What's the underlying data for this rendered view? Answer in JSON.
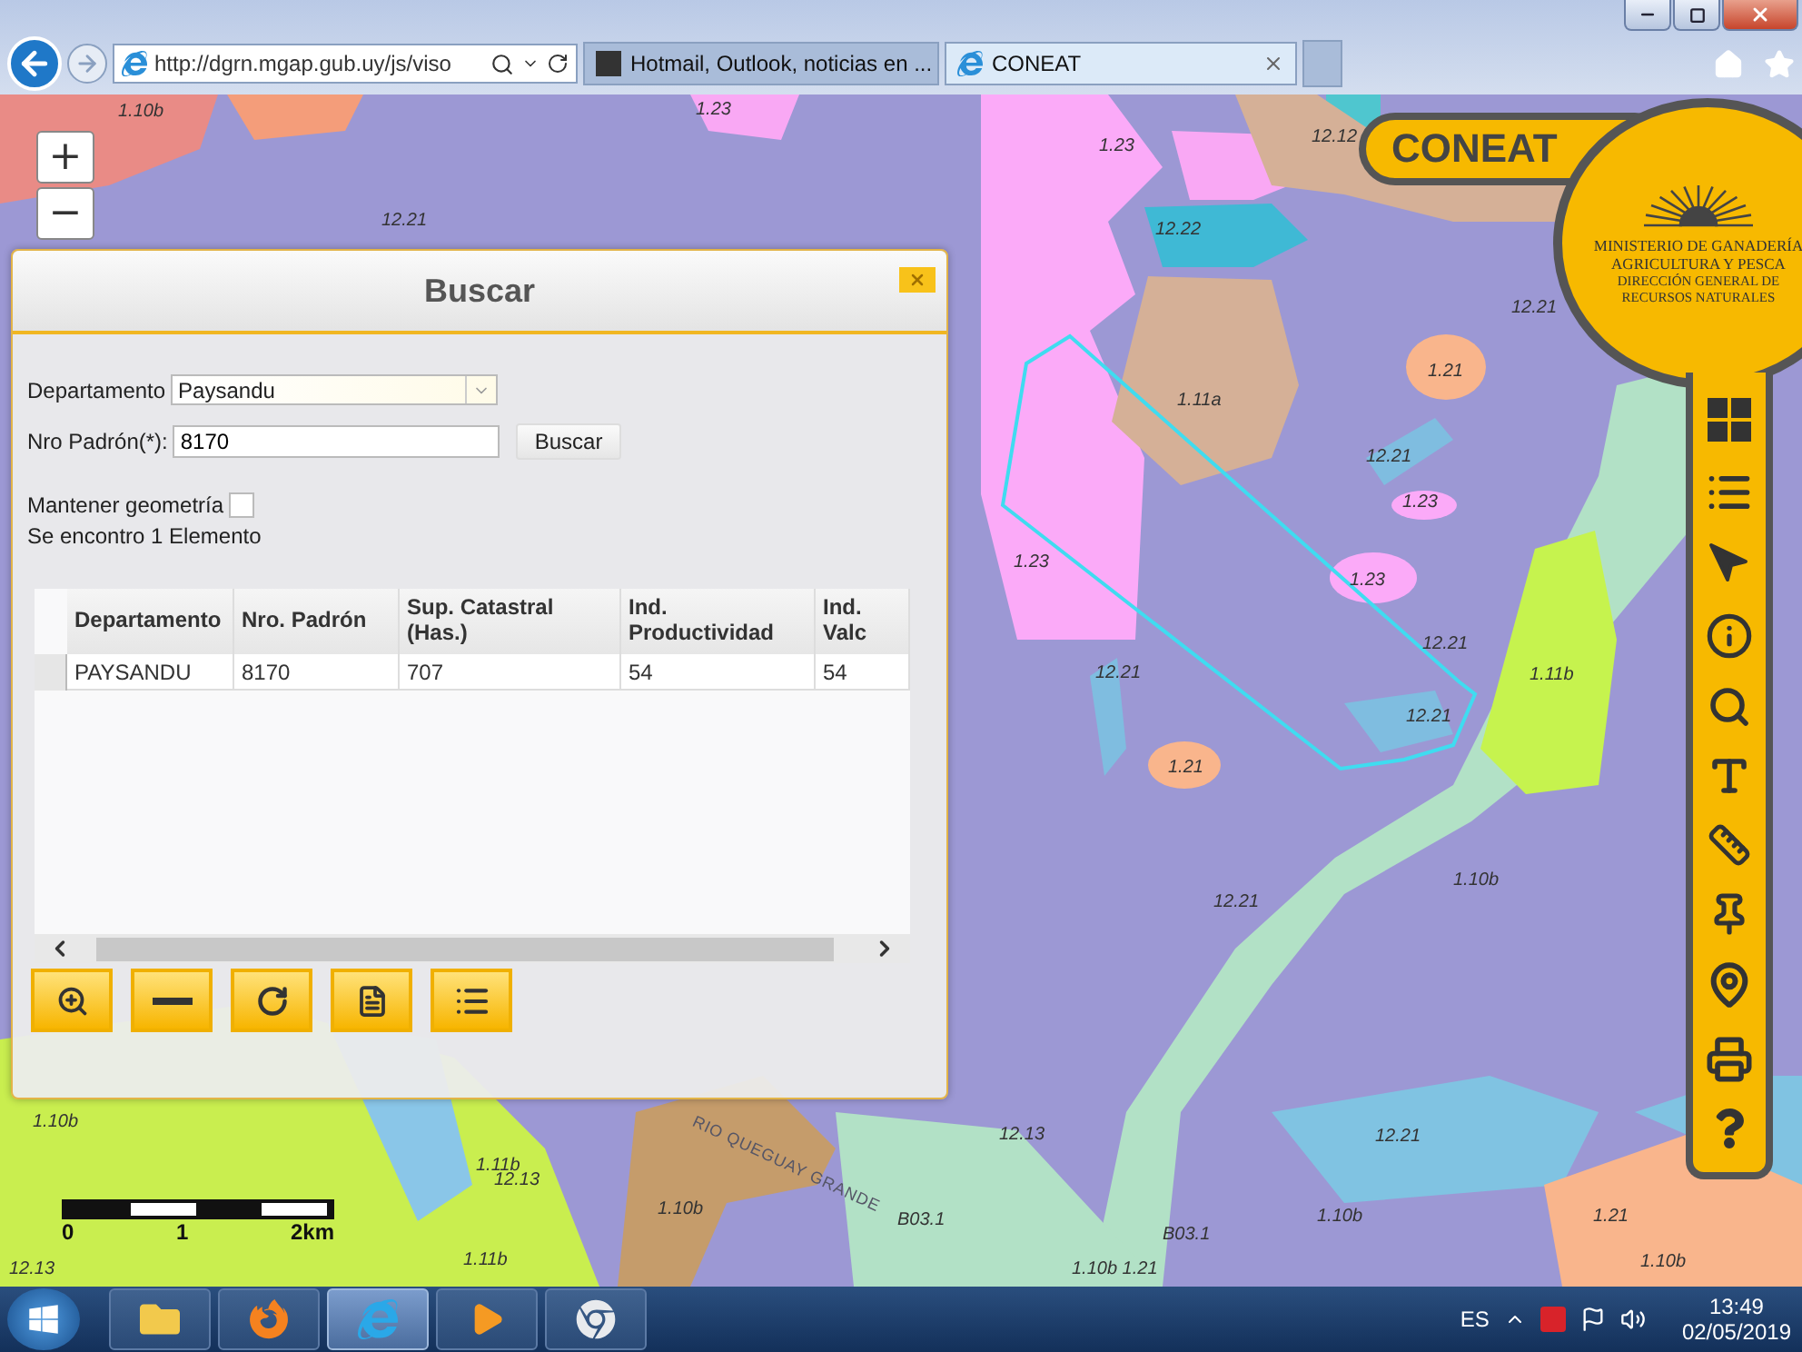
{
  "browser": {
    "address": "http://dgrn.mgap.gub.uy/js/viso",
    "tabs": [
      {
        "label": "Hotmail, Outlook, noticias en ...",
        "selected": false
      },
      {
        "label": "CONEAT",
        "selected": true
      }
    ]
  },
  "map": {
    "zoom": [
      "+",
      "−"
    ],
    "labels": [
      "1.10b",
      "1.23",
      "1.23",
      "12.12",
      "12.21",
      "12.22",
      "1.11a",
      "12.21",
      "1.21",
      "12.21",
      "1.23",
      "1.23",
      "1.23",
      "12.21",
      "1.11b",
      "12.21",
      "12.21",
      "1.21",
      "12.21",
      "1.10b",
      "1.10b",
      "12.13",
      "1.11b",
      "12.13",
      "12.21",
      "1.10b",
      "B03.1",
      "B03.1",
      "1.10b",
      "1.21",
      "1.10b 1.21",
      "1.10b",
      "12.13",
      "1.11b"
    ],
    "river_label": "RIO QUEGUAY GRANDE",
    "scale": [
      "0",
      "1",
      "2km"
    ]
  },
  "brand": {
    "logo": "CONEAT",
    "ministry": [
      "MINISTERIO DE GANADERÍA",
      "AGRICULTURA Y PESCA"
    ],
    "direction": [
      "DIRECCIÓN GENERAL DE",
      "RECURSOS NATURALES"
    ]
  },
  "dialog": {
    "title": "Buscar",
    "department": {
      "label": "Departamento",
      "value": "Paysandu"
    },
    "parcel": {
      "label": "Nro Padrón(*):",
      "value": "8170",
      "button": "Buscar"
    },
    "keep_geometry": {
      "label": "Mantener geometría",
      "checked": false
    },
    "result": "Se encontro 1 Elemento",
    "table": {
      "columns": [
        "Departamento",
        "Nro. Padrón",
        "Sup. Catastral (Has.)",
        "Ind. Productividad",
        "Ind. Valc"
      ],
      "rows": [
        [
          "PAYSANDU",
          "8170",
          "707",
          "54",
          "54"
        ]
      ]
    }
  },
  "taskbar": {
    "apps": [
      {
        "kind": "folder",
        "selected": false
      },
      {
        "kind": "firefox",
        "selected": false
      },
      {
        "kind": "ie",
        "selected": true
      },
      {
        "kind": "media",
        "selected": false
      },
      {
        "kind": "chrome",
        "selected": false
      }
    ],
    "language": "ES",
    "time": "13:49",
    "date": "02/05/2019"
  }
}
